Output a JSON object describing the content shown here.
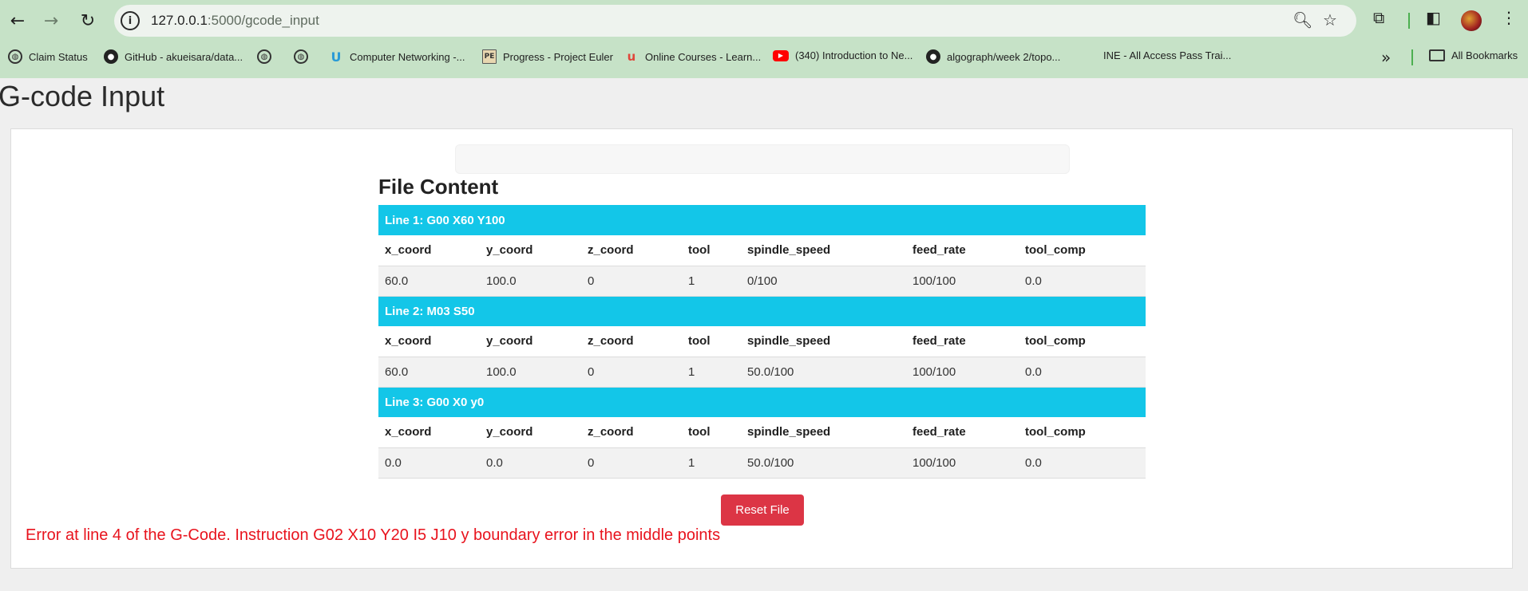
{
  "browser": {
    "url_host": "127.0.0.1",
    "url_path": ":5000/gcode_input",
    "bookmarks": [
      {
        "label": "Claim Status",
        "icon": "globe-icon"
      },
      {
        "label": "GitHub - akueisara/data...",
        "icon": "github-icon"
      },
      {
        "label": "",
        "icon": "globe-icon"
      },
      {
        "label": "",
        "icon": "globe-icon"
      },
      {
        "label": "Computer Networking -...",
        "icon": "udacity-icon"
      },
      {
        "label": "Progress - Project Euler",
        "icon": "project-euler-icon"
      },
      {
        "label": "Online Courses - Learn...",
        "icon": "udemy-icon"
      },
      {
        "label": "(340) Introduction to Ne...",
        "icon": "youtube-icon"
      },
      {
        "label": "algograph/week 2/topo...",
        "icon": "github-icon"
      },
      {
        "label": "INE - All Access Pass Trai...",
        "icon": "blank-icon"
      }
    ],
    "all_bookmarks_label": "All Bookmarks"
  },
  "page": {
    "title": "G-code Input",
    "section_title": "File Content",
    "reset_button_label": "Reset File",
    "error_message": "Error at line 4 of the G-Code. Instruction G02 X10 Y20 I5 J10 y boundary error in the middle points"
  },
  "table": {
    "columns": [
      "x_coord",
      "y_coord",
      "z_coord",
      "tool",
      "spindle_speed",
      "feed_rate",
      "tool_comp"
    ],
    "lines": [
      {
        "header": "Line 1: G00 X60 Y100",
        "values": [
          "60.0",
          "100.0",
          "0",
          "1",
          "0/100",
          "100/100",
          "0.0"
        ]
      },
      {
        "header": "Line 2: M03 S50",
        "values": [
          "60.0",
          "100.0",
          "0",
          "1",
          "50.0/100",
          "100/100",
          "0.0"
        ]
      },
      {
        "header": "Line 3: G00 X0 y0",
        "values": [
          "0.0",
          "0.0",
          "0",
          "1",
          "50.0/100",
          "100/100",
          "0.0"
        ]
      }
    ]
  },
  "colors": {
    "line_header_bg": "#13c6e8",
    "reset_button_bg": "#dc3545",
    "error_text": "#e8131d",
    "chrome_bg": "#c6e2c7"
  }
}
